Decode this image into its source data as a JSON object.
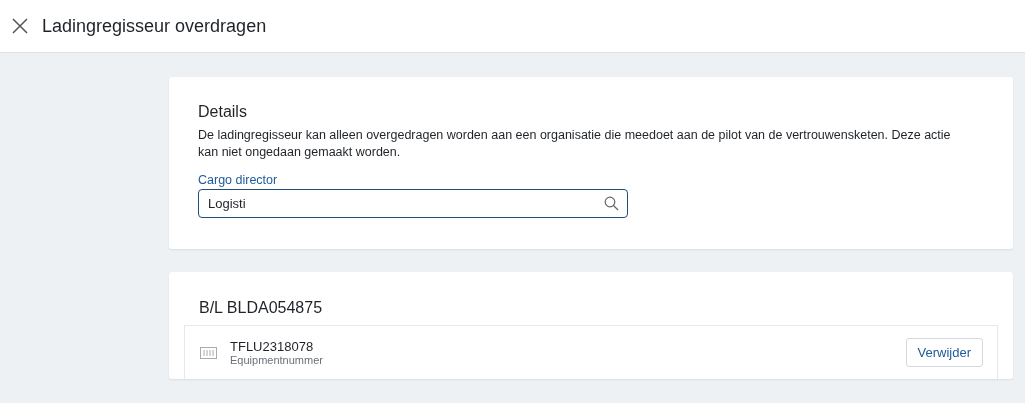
{
  "window": {
    "title": "Ladingregisseur overdragen"
  },
  "details": {
    "heading": "Details",
    "description": "De ladingregisseur kan alleen overgedragen worden aan een organisatie die meedoet aan de pilot van de vertrouwensketen. Deze actie kan niet ongedaan gemaakt worden.",
    "field": {
      "label": "Cargo director",
      "value": "Logisti",
      "focused": true
    }
  },
  "bill_of_lading": {
    "heading": "B/L BLDA054875",
    "items": [
      {
        "number": "TFLU2318078",
        "caption": "Equipmentnummer",
        "action": "Verwijder"
      }
    ]
  }
}
